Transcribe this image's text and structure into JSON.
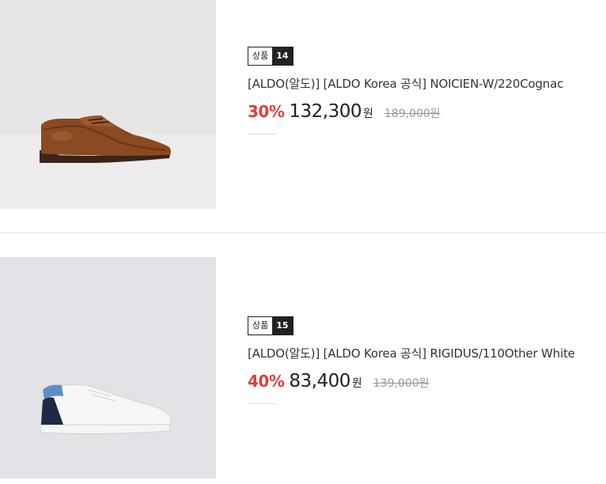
{
  "products": [
    {
      "badge_label": "상품",
      "badge_num": "14",
      "title": "[ALDO(알도)] [ALDO Korea 공식] NOICIEN-W/220Cognac",
      "discount": "30%",
      "price": "132,300",
      "currency": "원",
      "original_price": "189,000원",
      "image_icon": "brown-derby-shoe",
      "bg_color": "#e4e4e4"
    },
    {
      "badge_label": "상품",
      "badge_num": "15",
      "title": "[ALDO(알도)] [ALDO Korea 공식] RIGIDUS/110Other White",
      "discount": "40%",
      "price": "83,400",
      "currency": "원",
      "original_price": "139,000원",
      "image_icon": "white-sneaker",
      "bg_color": "#e3e2e6"
    }
  ],
  "colors": {
    "discount": "#e83a3a",
    "badge_dark": "#222222"
  }
}
